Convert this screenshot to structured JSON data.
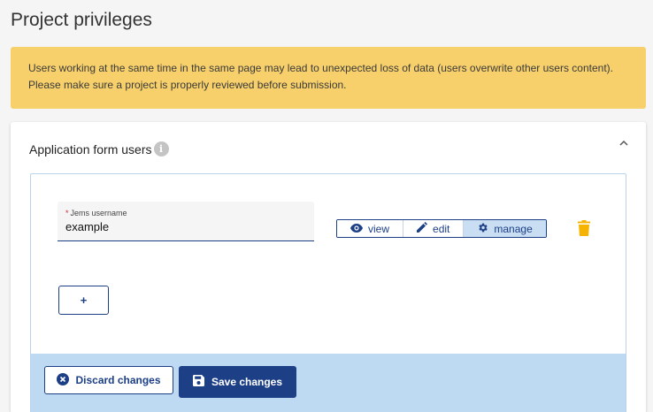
{
  "page": {
    "title": "Project privileges"
  },
  "warning": {
    "text": "Users working at the same time in the same page may lead to unexpected loss of data (users overwrite other users content). Please make sure a project is properly reviewed before submission."
  },
  "section": {
    "title": "Application form users",
    "info_icon": "info-icon",
    "collapse_icon": "chevron-up-icon"
  },
  "user_row": {
    "field_label": "Jems username",
    "required_marker": "*",
    "field_value": "example",
    "privileges": [
      {
        "label": "view",
        "icon": "eye-icon",
        "active": false
      },
      {
        "label": "edit",
        "icon": "pencil-icon",
        "active": false
      },
      {
        "label": "manage",
        "icon": "gear-icon",
        "active": true
      }
    ],
    "delete_icon": "trash-icon"
  },
  "add_button": {
    "label": "+"
  },
  "actions": {
    "discard_label": "Discard changes",
    "save_label": "Save changes"
  },
  "colors": {
    "primary": "#1c3f86",
    "warning_bg": "#f7d06b",
    "action_bar_bg": "#bddaf2",
    "active_toggle_bg": "#c9def3",
    "delete": "#f6b400",
    "required": "#d32f2f"
  }
}
